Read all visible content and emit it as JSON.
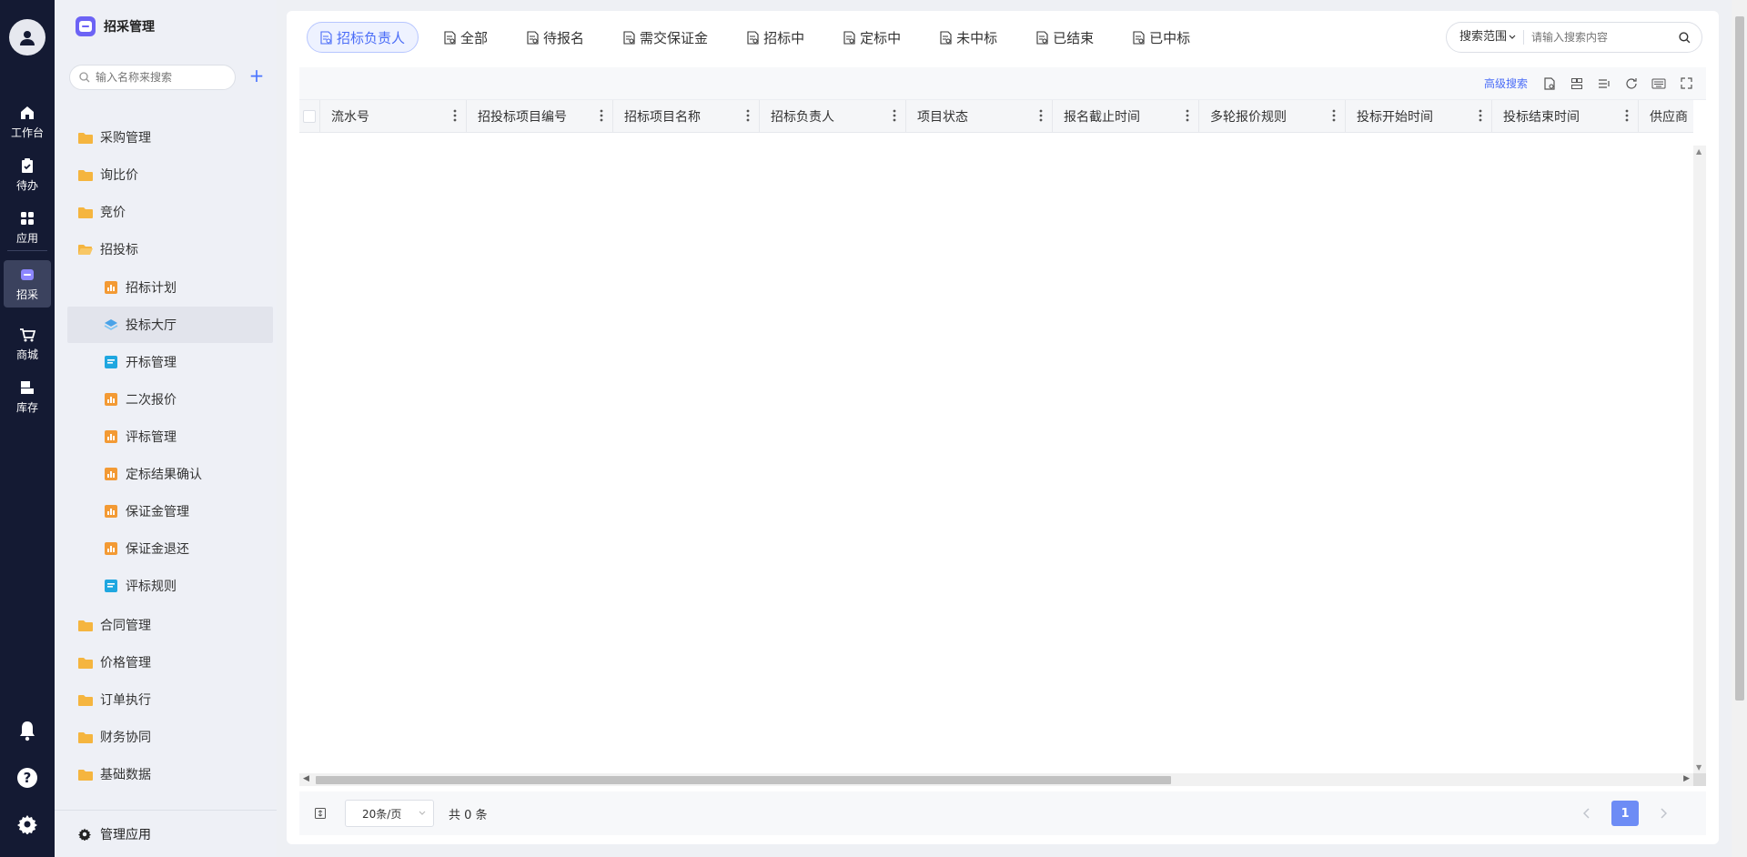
{
  "rail": {
    "items": [
      {
        "label": "工作台",
        "icon": "home-icon"
      },
      {
        "label": "待办",
        "icon": "clipboard-check-icon"
      },
      {
        "label": "应用",
        "icon": "apps-grid-icon"
      },
      {
        "label": "招采",
        "icon": "procurement-icon",
        "active": true
      },
      {
        "label": "商城",
        "icon": "cart-icon"
      },
      {
        "label": "库存",
        "icon": "inventory-icon"
      }
    ]
  },
  "menu": {
    "title": "招采管理",
    "search_placeholder": "输入名称来搜索",
    "items": [
      {
        "label": "采购管理",
        "level": 0,
        "icon": "folder-icon"
      },
      {
        "label": "询比价",
        "level": 0,
        "icon": "folder-icon"
      },
      {
        "label": "竞价",
        "level": 0,
        "icon": "folder-icon"
      },
      {
        "label": "招投标",
        "level": 0,
        "icon": "folder-open-icon"
      },
      {
        "label": "招标计划",
        "level": 1,
        "icon": "chart-doc-icon"
      },
      {
        "label": "投标大厅",
        "level": 1,
        "icon": "layers-icon",
        "active": true
      },
      {
        "label": "开标管理",
        "level": 1,
        "icon": "form-doc-icon"
      },
      {
        "label": "二次报价",
        "level": 1,
        "icon": "chart-doc-icon"
      },
      {
        "label": "评标管理",
        "level": 1,
        "icon": "chart-doc-icon"
      },
      {
        "label": "定标结果确认",
        "level": 1,
        "icon": "chart-doc-icon"
      },
      {
        "label": "保证金管理",
        "level": 1,
        "icon": "chart-doc-icon"
      },
      {
        "label": "保证金退还",
        "level": 1,
        "icon": "chart-doc-icon"
      },
      {
        "label": "评标规则",
        "level": 1,
        "icon": "form-doc-icon"
      },
      {
        "label": "合同管理",
        "level": 0,
        "icon": "folder-icon"
      },
      {
        "label": "价格管理",
        "level": 0,
        "icon": "folder-icon"
      },
      {
        "label": "订单执行",
        "level": 0,
        "icon": "folder-icon"
      },
      {
        "label": "财务协同",
        "level": 0,
        "icon": "folder-icon"
      },
      {
        "label": "基础数据",
        "level": 0,
        "icon": "folder-icon"
      }
    ],
    "footer_label": "管理应用"
  },
  "tabs": [
    {
      "label": "招标负责人",
      "active": true
    },
    {
      "label": "全部"
    },
    {
      "label": "待报名"
    },
    {
      "label": "需交保证金"
    },
    {
      "label": "招标中"
    },
    {
      "label": "定标中"
    },
    {
      "label": "未中标"
    },
    {
      "label": "已结束"
    },
    {
      "label": "已中标"
    }
  ],
  "search": {
    "scope_label": "搜索范围",
    "placeholder": "请输入搜索内容"
  },
  "toolbar": {
    "advanced_search": "高级搜索"
  },
  "table": {
    "columns": [
      "流水号",
      "招投标项目编号",
      "招标项目名称",
      "招标负责人",
      "项目状态",
      "报名截止时间",
      "多轮报价规则",
      "投标开始时间",
      "投标结束时间",
      "供应商"
    ],
    "rows": []
  },
  "pager": {
    "page_size": "20条/页",
    "total": "共 0 条",
    "current_page": "1"
  },
  "colors": {
    "rail_bg": "#141a33",
    "accent": "#4a6cf7",
    "folder": "#f5b53f"
  }
}
